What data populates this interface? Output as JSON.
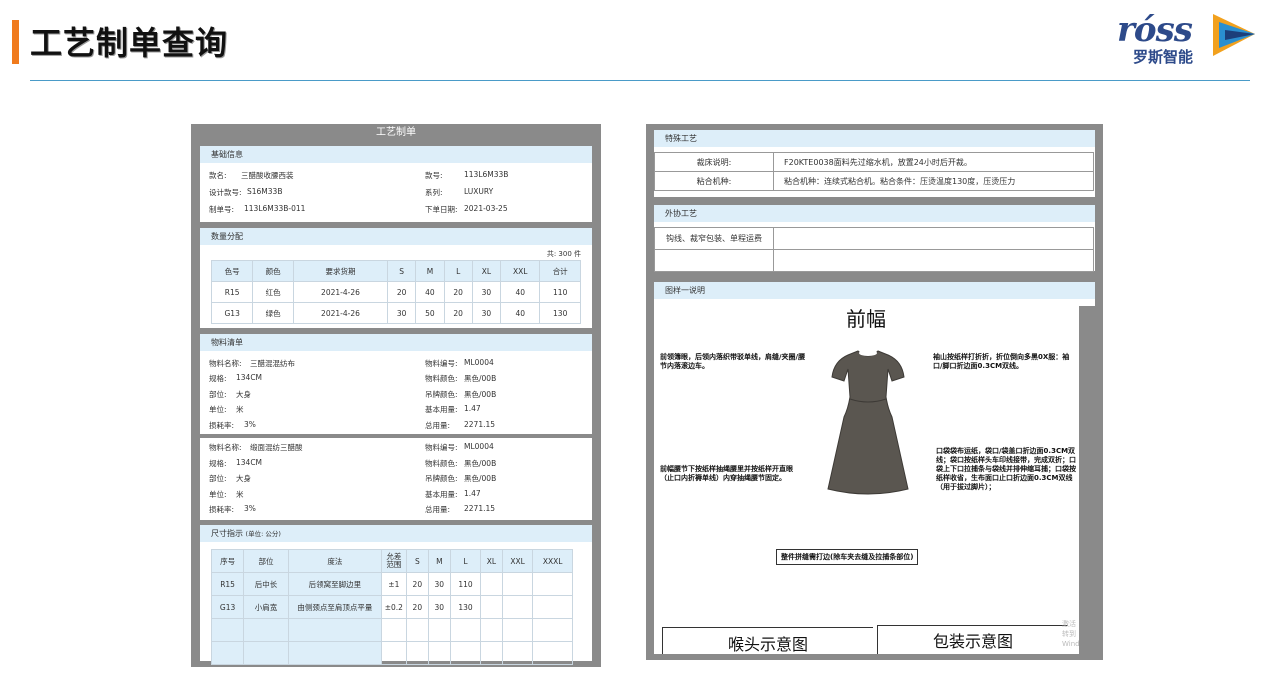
{
  "header": {
    "title": "工艺制单查询",
    "logo_word": "róss",
    "logo_cn": "罗斯智能"
  },
  "left_panel": {
    "title": "工艺制单",
    "basic": {
      "title": "基础信息",
      "rows": [
        {
          "l": "款名:",
          "lv": "三醋酸收腰西装",
          "r": "款号:",
          "rv": "113L6M33B"
        },
        {
          "l": "设计款号:",
          "lv": "S16M33B",
          "r": "系列:",
          "rv": "LUXURY"
        },
        {
          "l": "制单号:",
          "lv": "113L6M33B-011",
          "r": "下单日期:",
          "rv": "2021-03-25"
        }
      ]
    },
    "qty": {
      "title": "数量分配",
      "total": "共: 300 件",
      "headers": [
        "色号",
        "颜色",
        "要求货期",
        "S",
        "M",
        "L",
        "XL",
        "XXL",
        "合计"
      ],
      "rows": [
        [
          "R15",
          "红色",
          "2021-4-26",
          "20",
          "40",
          "20",
          "30",
          "40",
          "110"
        ],
        [
          "G13",
          "绿色",
          "2021-4-26",
          "30",
          "50",
          "20",
          "30",
          "40",
          "130"
        ]
      ]
    },
    "materials": [
      {
        "title": "物料清单",
        "rows": [
          {
            "l": "物料名称:",
            "lv": "三醋混混纺布",
            "r": "物料编号:",
            "rv": "ML0004"
          },
          {
            "l": "规格:",
            "lv": "134CM",
            "r": "物料颜色:",
            "rv": "黑色/00B"
          },
          {
            "l": "部位:",
            "lv": "大身",
            "r": "吊牌颜色:",
            "rv": "黑色/00B"
          },
          {
            "l": "单位:",
            "lv": "米",
            "r": "基本用量:",
            "rv": "1.47"
          },
          {
            "l": "损耗率:",
            "lv": "3%",
            "r": "总用量:",
            "rv": "2271.15"
          }
        ]
      },
      {
        "title": "",
        "rows": [
          {
            "l": "物料名称:",
            "lv": "缎面混纺三醋酸",
            "r": "物料编号:",
            "rv": "ML0004"
          },
          {
            "l": "规格:",
            "lv": "134CM",
            "r": "物料颜色:",
            "rv": "黑色/00B"
          },
          {
            "l": "部位:",
            "lv": "大身",
            "r": "吊牌颜色:",
            "rv": "黑色/00B"
          },
          {
            "l": "单位:",
            "lv": "米",
            "r": "基本用量:",
            "rv": "1.47"
          },
          {
            "l": "损耗率:",
            "lv": "3%",
            "r": "总用量:",
            "rv": "2271.15"
          }
        ]
      }
    ],
    "size": {
      "title": "尺寸指示",
      "unit": "(单位: 公分)",
      "headers": [
        "序号",
        "部位",
        "度法",
        "允差范围",
        "S",
        "M",
        "L",
        "XL",
        "XXL",
        "XXXL"
      ],
      "rows": [
        [
          "R15",
          "后中长",
          "后领窝至脚边里",
          "±1",
          "20",
          "30",
          "110",
          "",
          "",
          ""
        ],
        [
          "G13",
          "小肩宽",
          "由侧颈点至肩顶点平量",
          "±0.2",
          "20",
          "30",
          "130",
          "",
          "",
          ""
        ],
        [
          "",
          "",
          "",
          "",
          "",
          "",
          "",
          "",
          "",
          ""
        ],
        [
          "",
          "",
          "",
          "",
          "",
          "",
          "",
          "",
          "",
          ""
        ]
      ]
    }
  },
  "right_panel": {
    "special": {
      "title": "特殊工艺",
      "rows": [
        [
          "裁床说明:",
          "F20KTE0038面料先过缩水机，放置24小时后开裁。"
        ],
        [
          "粘合机种:",
          "粘合机种：连续式粘合机。粘合条件：压烫温度130度，压烫压力"
        ]
      ]
    },
    "outsource": {
      "title": "外协工艺",
      "rows": [
        [
          "钩线、裁窄包装、单程运费",
          ""
        ],
        [
          "",
          ""
        ]
      ]
    },
    "drawing": {
      "title": "图样一说明",
      "front_label": "前幅",
      "notes": {
        "left_top": "前领簿眼，后领内落织带驳单线，肩缝/夹圈/腰节内落滚边车。",
        "right_top": "袖山按纸样打折折，折位倒向多黑0X服：袖口/脚口折边面0.3CM双线。",
        "left_bottom": "前幅腰节下按纸样抽绳腰里并按纸样开直眼（止口内折褥单线）内穿抽绳腰节固定。",
        "right_bottom": "口袋袋布运纸，袋口/袋盖口折边面0.3CM双线；袋口按纸样头车印线接带，完成双折；口袋上下口拉捕条与袋线并排伸缩耳捕；口袋按纸样收省，生布面口止口折边面0.3CM双线（用于拔过脚片）；",
        "bottom": "整件拼缝需打边(除车夹去缝及拉捕条部位)",
        "left_box": "喉头示意图",
        "right_box": "包装示意图",
        "watermark": "激活 转到 Wind"
      }
    }
  }
}
